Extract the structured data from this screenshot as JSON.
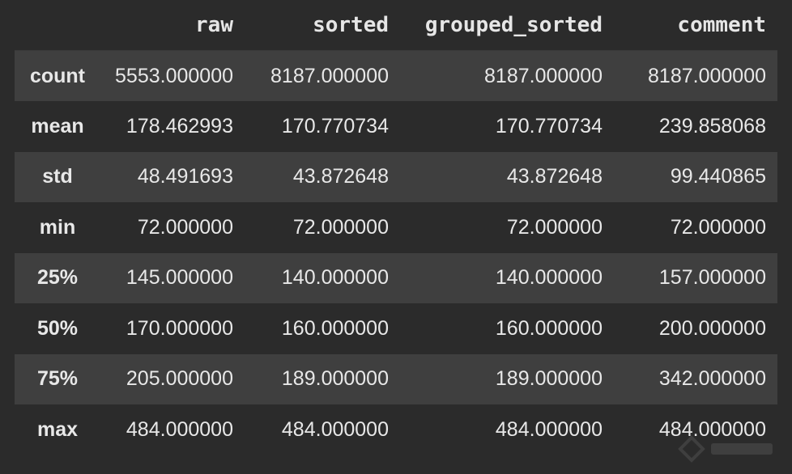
{
  "table": {
    "columns": [
      "",
      "raw",
      "sorted",
      "grouped_sorted",
      "comment"
    ],
    "rows": [
      {
        "label": "count",
        "values": [
          "5553.000000",
          "8187.000000",
          "8187.000000",
          "8187.000000"
        ]
      },
      {
        "label": "mean",
        "values": [
          "178.462993",
          "170.770734",
          "170.770734",
          "239.858068"
        ]
      },
      {
        "label": "std",
        "values": [
          "48.491693",
          "43.872648",
          "43.872648",
          "99.440865"
        ]
      },
      {
        "label": "min",
        "values": [
          "72.000000",
          "72.000000",
          "72.000000",
          "72.000000"
        ]
      },
      {
        "label": "25%",
        "values": [
          "145.000000",
          "140.000000",
          "140.000000",
          "157.000000"
        ]
      },
      {
        "label": "50%",
        "values": [
          "170.000000",
          "160.000000",
          "160.000000",
          "200.000000"
        ]
      },
      {
        "label": "75%",
        "values": [
          "205.000000",
          "189.000000",
          "189.000000",
          "342.000000"
        ]
      },
      {
        "label": "max",
        "values": [
          "484.000000",
          "484.000000",
          "484.000000",
          "484.000000"
        ]
      }
    ]
  },
  "colors": {
    "background": "#2b2b2b",
    "row_striped": "#3f3f3f",
    "text": "#e8e8e8"
  }
}
